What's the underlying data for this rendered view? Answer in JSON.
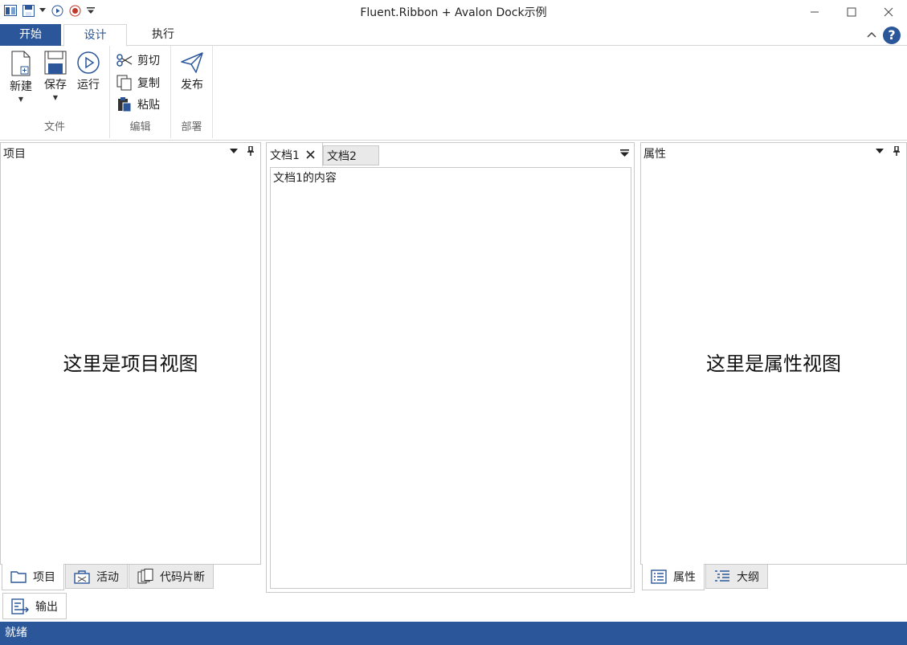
{
  "window": {
    "title": "Fluent.Ribbon + Avalon Dock示例"
  },
  "ribbon": {
    "tabs": [
      "开始",
      "设计",
      "执行"
    ],
    "groups": {
      "file": {
        "label": "文件",
        "new": "新建",
        "save": "保存",
        "run": "运行"
      },
      "edit": {
        "label": "编辑",
        "cut": "剪切",
        "copy": "复制",
        "paste": "粘贴"
      },
      "deploy": {
        "label": "部署",
        "publish": "发布"
      }
    }
  },
  "left_pane": {
    "title": "项目",
    "content": "这里是项目视图",
    "tabs": [
      "项目",
      "活动",
      "代码片断"
    ]
  },
  "documents": {
    "tabs": [
      "文档1",
      "文档2"
    ],
    "content": "文档1的内容"
  },
  "right_pane": {
    "title": "属性",
    "content": "这里是属性视图",
    "tabs": [
      "属性",
      "大纲"
    ]
  },
  "bottom": {
    "output_tab": "输出"
  },
  "status": {
    "text": "就绪"
  },
  "colors": {
    "accent": "#2b579a",
    "border": "#c9c9c9"
  }
}
